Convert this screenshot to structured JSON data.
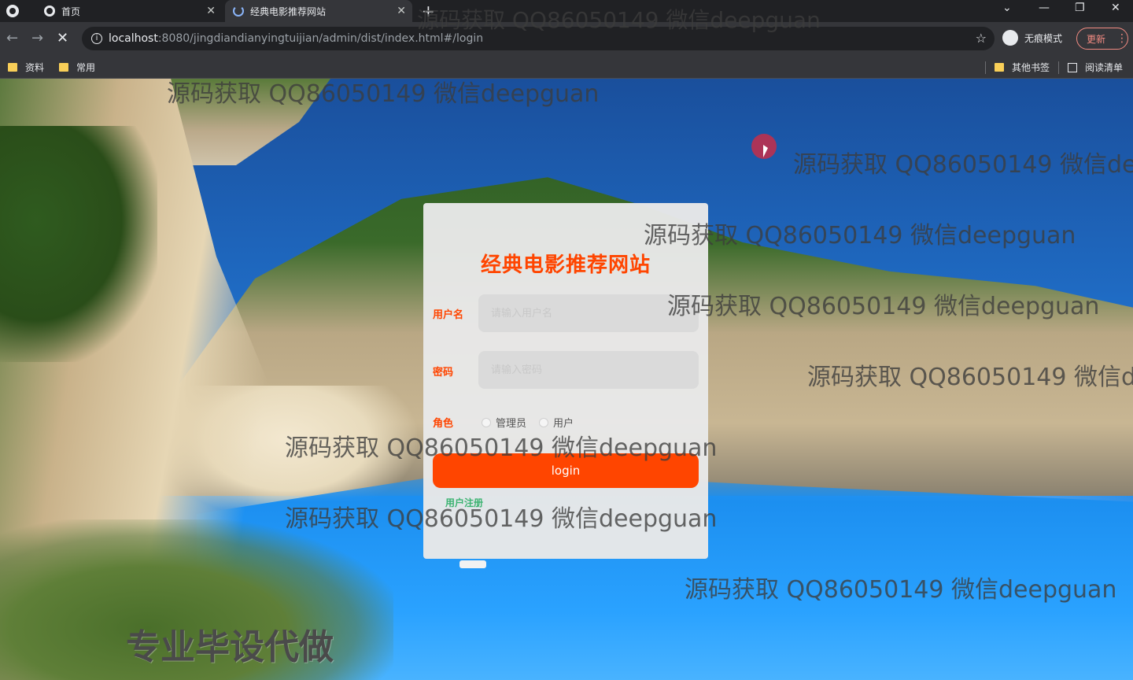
{
  "browser": {
    "tabs": [
      {
        "label": "首页"
      },
      {
        "label": "经典电影推荐网站"
      }
    ],
    "url_host": "localhost",
    "url_rest": ":8080/jingdiandianyingtuijian/admin/dist/index.html#/login",
    "incognito_label": "无痕模式",
    "update_label": "更新",
    "bookmarks": [
      "资料",
      "常用"
    ],
    "other_bookmarks": "其他书签",
    "reading_list": "阅读清单"
  },
  "login": {
    "title": "经典电影推荐网站",
    "username_label": "用户名",
    "username_placeholder": "请输入用户名",
    "password_label": "密码",
    "password_placeholder": "请输入密码",
    "role_label": "角色",
    "role_options": [
      "管理员",
      "用户"
    ],
    "login_button": "login",
    "register_link": "用户注册"
  },
  "watermarks": {
    "text_1": "源码获取 QQ86050149 微信deepguan",
    "text_2": "源码获取 QQ86050149 微信deepguan",
    "text_3": "源码获取 QQ86050149 微信dee",
    "text_4": "源码获取 QQ86050149 微信deepguan",
    "text_5": "源码获取 QQ86050149 微信deepguan",
    "text_6": "源码获取 QQ86050149 微信de",
    "text_7": "源码获取 QQ86050149 微信deepguan",
    "text_8": "源码获取 QQ86050149 微信deepguan",
    "text_9": "源码获取 QQ86050149 微信deepguan",
    "text_10": "源码获取 QQ86050149 微信deepguan",
    "big": "专业毕设代做"
  }
}
